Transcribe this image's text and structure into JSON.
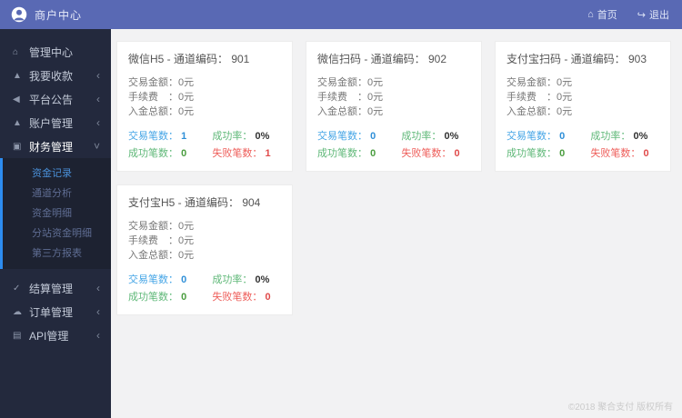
{
  "header": {
    "title": "商户中心",
    "home_label": "首页",
    "home_icon": "⌂",
    "logout_label": "退出",
    "logout_icon": "↪"
  },
  "sidebar": {
    "chevron_collapsed": "‹",
    "chevron_expanded": "˅",
    "items": [
      {
        "label": "管理中心",
        "icon": "⌂"
      },
      {
        "label": "我要收款",
        "icon": "▲"
      },
      {
        "label": "平台公告",
        "icon": "◀"
      },
      {
        "label": "账户管理",
        "icon": "▲"
      },
      {
        "label": "财务管理",
        "icon": "▣"
      },
      {
        "label": "结算管理",
        "icon": "✓"
      },
      {
        "label": "订单管理",
        "icon": "☁"
      },
      {
        "label": "API管理",
        "icon": "▤"
      }
    ],
    "finance_submenu": [
      {
        "label": "资金记录"
      },
      {
        "label": "通道分析"
      },
      {
        "label": "资金明细"
      },
      {
        "label": "分站资金明细"
      },
      {
        "label": "第三方报表"
      }
    ]
  },
  "card_labels": {
    "amount": "交易金额：",
    "fee": "手续费　：",
    "deposit": "入金总额：",
    "tx_count": "交易笔数：",
    "success_rate": "成功率：",
    "success_count": "成功笔数：",
    "fail_count": "失败笔数："
  },
  "cards": [
    {
      "title": "微信H5 - 通道编码： 901",
      "amount": "0元",
      "fee": "0元",
      "deposit": "0元",
      "tx_count": "1",
      "success_rate": "0%",
      "success_count": "0",
      "fail_count": "1"
    },
    {
      "title": "微信扫码 - 通道编码： 902",
      "amount": "0元",
      "fee": "0元",
      "deposit": "0元",
      "tx_count": "0",
      "success_rate": "0%",
      "success_count": "0",
      "fail_count": "0"
    },
    {
      "title": "支付宝扫码 - 通道编码： 903",
      "amount": "0元",
      "fee": "0元",
      "deposit": "0元",
      "tx_count": "0",
      "success_rate": "0%",
      "success_count": "0",
      "fail_count": "0"
    },
    {
      "title": "支付宝H5 - 通道编码： 904",
      "amount": "0元",
      "fee": "0元",
      "deposit": "0元",
      "tx_count": "0",
      "success_rate": "0%",
      "success_count": "0",
      "fail_count": "0"
    }
  ],
  "footer": {
    "copyright": "©2018 聚合支付 版权所有"
  },
  "colors": {
    "header_bg": "#5969b4",
    "sidebar_bg": "#23293d",
    "submenu_accent": "#2d8cf0",
    "stat_blue": "#45a5e6",
    "stat_green": "#5fb878",
    "stat_red": "#ee5f5b"
  }
}
